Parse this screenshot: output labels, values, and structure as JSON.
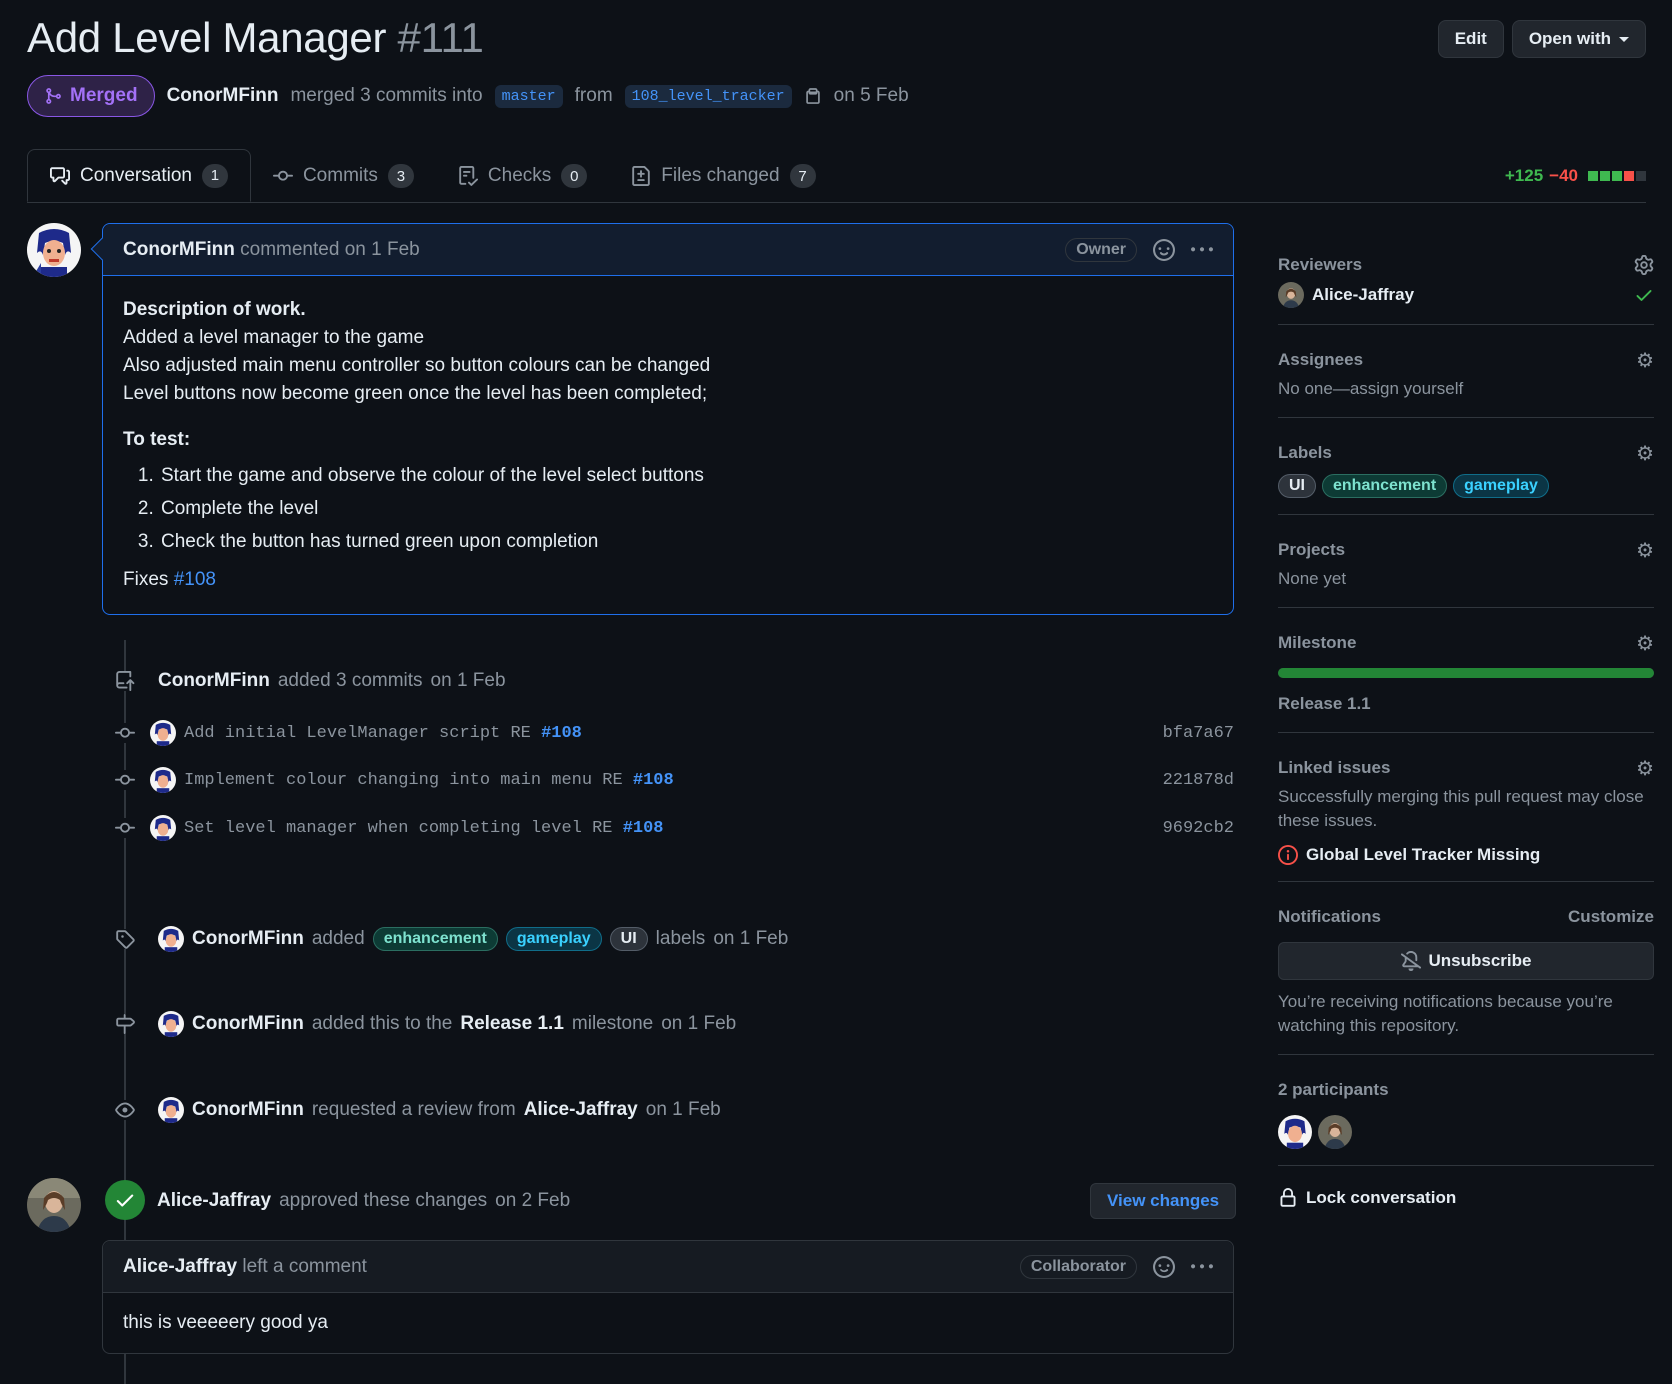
{
  "pr": {
    "title": "Add Level Manager",
    "number": "#111",
    "state": "Merged",
    "author": "ConorMFinn",
    "merge_text": "merged 3 commits into",
    "base_branch": "master",
    "from_text": "from",
    "head_branch": "108_level_tracker",
    "merged_on": "on 5 Feb"
  },
  "header_actions": {
    "edit": "Edit",
    "open_with": "Open with"
  },
  "tabs": [
    {
      "label": "Conversation",
      "count": "1"
    },
    {
      "label": "Commits",
      "count": "3"
    },
    {
      "label": "Checks",
      "count": "0"
    },
    {
      "label": "Files changed",
      "count": "7"
    }
  ],
  "diffstat": {
    "additions": "+125",
    "deletions": "−40",
    "blocks": [
      "#3fb950",
      "#3fb950",
      "#3fb950",
      "#f85149",
      "#30363d"
    ]
  },
  "main_comment": {
    "author": "ConorMFinn",
    "action": "commented",
    "date": "on 1 Feb",
    "role": "Owner",
    "desc_heading": "Description of work.",
    "desc_lines": [
      "Added a level manager to the game",
      "Also adjusted main menu controller so button colours can be changed",
      "Level buttons now become green once the level has been completed;"
    ],
    "test_heading": "To test:",
    "test_steps": [
      "Start the game and observe the colour of the level select buttons",
      "Complete the level",
      "Check the button has turned green upon completion"
    ],
    "fixes_label": "Fixes",
    "fixes_ref": "#108"
  },
  "commits_event": {
    "author": "ConorMFinn",
    "text": "added 3 commits",
    "date": "on 1 Feb"
  },
  "commits": [
    {
      "message": "Add initial LevelManager script RE",
      "ref": "#108",
      "sha": "bfa7a67"
    },
    {
      "message": "Implement colour changing into main menu RE",
      "ref": "#108",
      "sha": "221878d"
    },
    {
      "message": "Set level manager when completing level RE",
      "ref": "#108",
      "sha": "9692cb2"
    }
  ],
  "labels_event": {
    "author": "ConorMFinn",
    "added": "added",
    "labels": [
      "enhancement",
      "gameplay",
      "UI"
    ],
    "suffix": "labels",
    "date": "on 1 Feb"
  },
  "milestone_event": {
    "author": "ConorMFinn",
    "text1": "added this to the",
    "milestone": "Release 1.1",
    "text2": "milestone",
    "date": "on 1 Feb"
  },
  "review_request_event": {
    "author": "ConorMFinn",
    "text": "requested a review from",
    "reviewer": "Alice-Jaffray",
    "date": "on 1 Feb"
  },
  "approval": {
    "author": "Alice-Jaffray",
    "text": "approved these changes",
    "date": "on 2 Feb",
    "button": "View changes"
  },
  "review_comment": {
    "author": "Alice-Jaffray",
    "action": "left a comment",
    "role": "Collaborator",
    "body": "this is veeeeery good ya"
  },
  "sidebar": {
    "reviewers": {
      "title": "Reviewers",
      "name": "Alice-Jaffray"
    },
    "assignees": {
      "title": "Assignees",
      "text": "No one—assign yourself"
    },
    "labels": {
      "title": "Labels",
      "items": [
        "UI",
        "enhancement",
        "gameplay"
      ]
    },
    "projects": {
      "title": "Projects",
      "text": "None yet"
    },
    "milestone": {
      "title": "Milestone",
      "name": "Release 1.1",
      "progress": 1.0
    },
    "linked_issues": {
      "title": "Linked issues",
      "text": "Successfully merging this pull request may close these issues.",
      "issue": "Global Level Tracker Missing"
    },
    "notifications": {
      "title": "Notifications",
      "customize": "Customize",
      "button": "Unsubscribe",
      "text": "You’re receiving notifications because you’re watching this repository."
    },
    "participants": {
      "title": "2 participants"
    },
    "lock": "Lock conversation"
  }
}
